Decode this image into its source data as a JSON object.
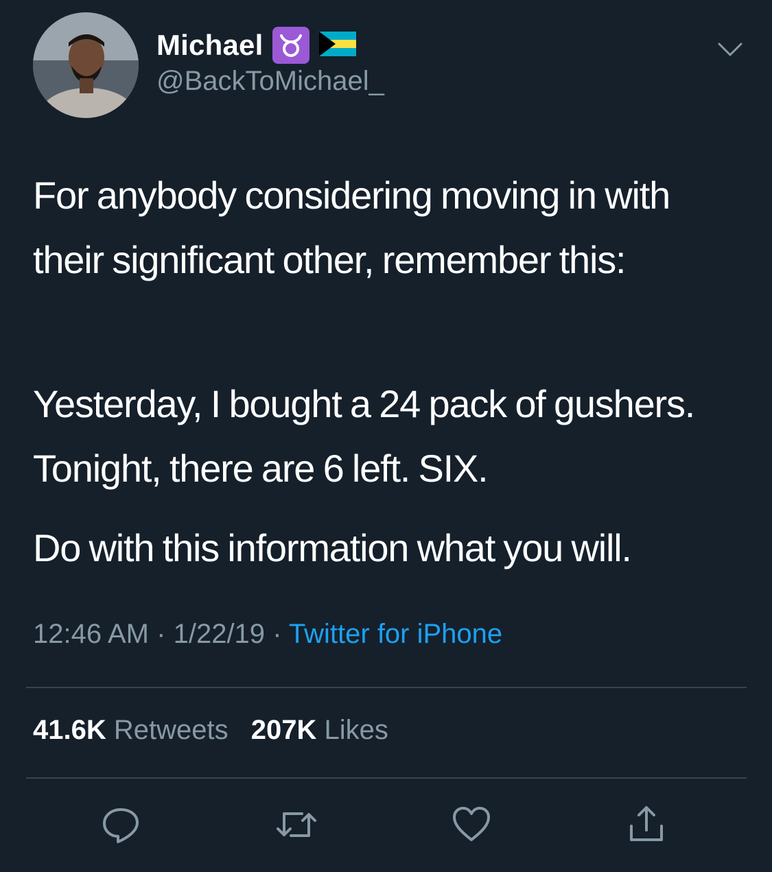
{
  "user": {
    "display_name": "Michael",
    "handle": "@BackToMichael_",
    "badges": [
      "taurus-emoji-icon",
      "bahamas-flag-icon"
    ]
  },
  "tweet": {
    "paragraphs": [
      "For anybody considering moving in with their significant other, remember this:",
      "Yesterday, I bought a 24 pack of gushers. Tonight, there are 6 left. SIX.",
      "Do with this information what you will."
    ],
    "time": "12:46 AM",
    "date": "1/22/19",
    "separator": "·",
    "source": "Twitter for iPhone"
  },
  "stats": {
    "retweets_count": "41.6K",
    "retweets_label": "Retweets",
    "likes_count": "207K",
    "likes_label": "Likes"
  },
  "actions": [
    "reply-icon",
    "retweet-icon",
    "like-icon",
    "share-icon"
  ],
  "colors": {
    "background": "#15202b",
    "primary_text": "#ffffff",
    "secondary_text": "#8899a6",
    "link": "#1da1f2",
    "divider": "#38444d",
    "taurus_badge": "#9b59d6"
  }
}
